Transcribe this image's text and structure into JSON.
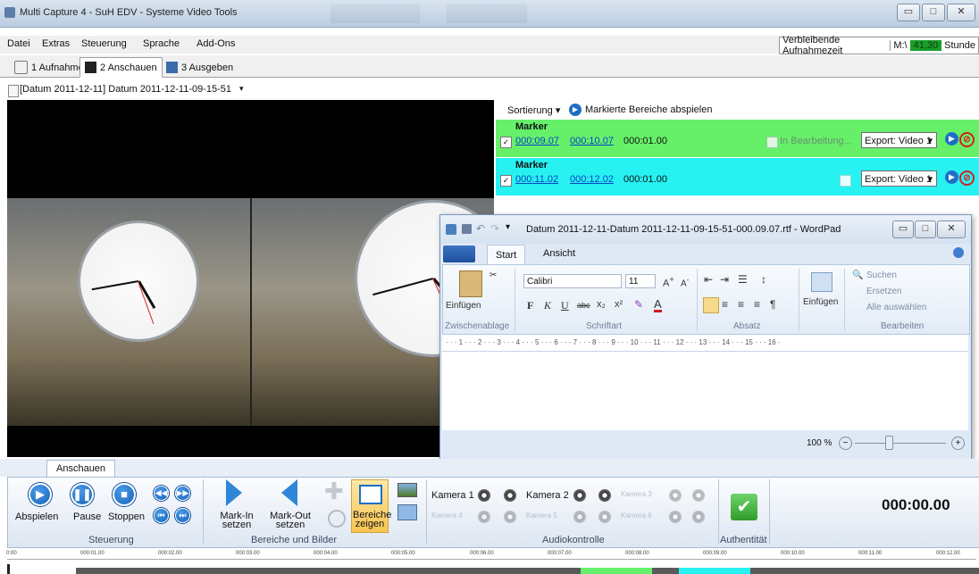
{
  "window": {
    "title": "Multi Capture 4 - SuH EDV - Systeme Video Tools",
    "minimize": "▭",
    "maximize": "□",
    "close": "✕"
  },
  "menu": [
    "Datei",
    "Extras",
    "Steuerung",
    "Sprache",
    "Add-Ons"
  ],
  "status": {
    "label": "Verbleibende Aufnahmezeit",
    "drive": "M:\\",
    "value": "41,30",
    "unit": "Stunde"
  },
  "tabs": [
    "1 Aufnahme",
    "2 Anschauen",
    "3 Ausgeben"
  ],
  "path": "[Datum 2011-12-11] Datum 2011-12-11-09-15-51",
  "markerbar": {
    "sort": "Sortierung",
    "play_marked": "Markierte Bereiche abspielen"
  },
  "markers": [
    {
      "title": "Marker",
      "in": "000:09.07",
      "out": "000:10.07",
      "duration": "000:01.00",
      "status": "In Bearbeitung...",
      "export": "Export: Video 1",
      "checked": "✓",
      "color": "#66f06a"
    },
    {
      "title": "Marker",
      "in": "000:11.02",
      "out": "000:12.02",
      "duration": "000:01.00",
      "status": "",
      "export": "Export: Video 1",
      "checked": "✓",
      "color": "#27f1f1"
    }
  ],
  "wordpad": {
    "title": "Datum 2011-12-11-Datum 2011-12-11-09-15-51-000.09.07.rtf - WordPad",
    "tabs": [
      "Start",
      "Ansicht"
    ],
    "paste": "Einfügen",
    "group_clipboard": "Zwischenablage",
    "font": "Calibri",
    "size": "11",
    "bold": "F",
    "italic": "K",
    "underline": "U",
    "strike": "abc",
    "subscript": "x₂",
    "superscript": "x²",
    "group_font": "Schriftart",
    "group_paragraph": "Absatz",
    "insert": "Einfügen",
    "find": "Suchen",
    "replace": "Ersetzen",
    "select_all": "Alle auswählen",
    "group_edit": "Bearbeiten",
    "ruler": "· · · 1 · · · 2 · · · 3 · · · 4 · · · 5 · · · 6 · · · 7 · · · 8 · · · 9 · · · 10 · · · 11 · · · 12 · · · 13 · · · 14 · · · 15 · · · 16 ·",
    "zoom": "100 %",
    "zoom_minus": "−",
    "zoom_plus": "+"
  },
  "bottom": {
    "tab": "Anschauen",
    "play": "Abspielen",
    "pause": "Pause",
    "stop": "Stoppen",
    "group_control": "Steuerung",
    "mark_in": "Mark-In setzen",
    "mark_out": "Mark-Out setzen",
    "show_ranges": "Bereiche zeigen",
    "group_ranges": "Bereiche und Bilder",
    "cams": [
      "Kamera 1",
      "Kamera 2",
      "Kamera 3",
      "Kamera 4",
      "Kamera 5",
      "Kamera 6"
    ],
    "group_audio": "Audiokontrolle",
    "group_auth": "Authentität",
    "time": "000:00.00"
  },
  "timeline": [
    "0:00",
    "000:01.00",
    "000:02.00",
    "000:03.00",
    "000:04.00",
    "000:05.00",
    "000:06.00",
    "000:07.00",
    "000:08.00",
    "000:09.00",
    "000:10.00",
    "000:11.00",
    "000:12.00"
  ]
}
